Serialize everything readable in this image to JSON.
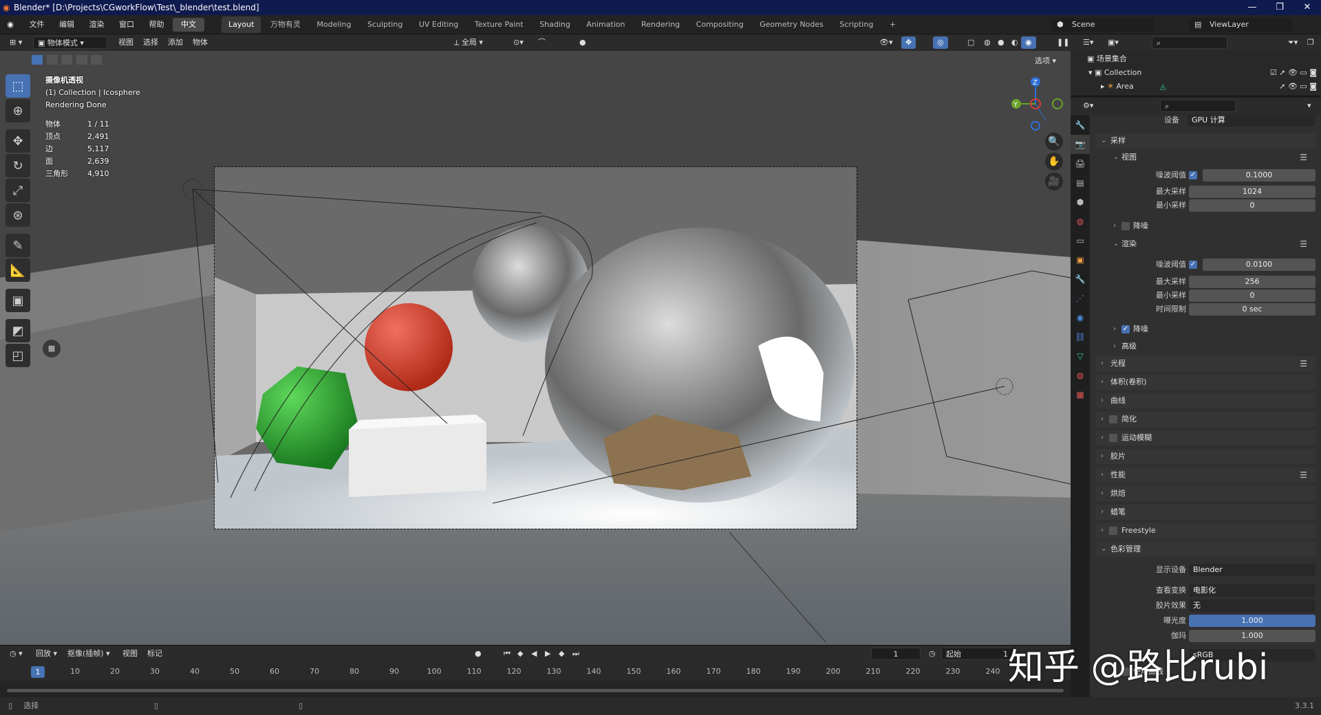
{
  "window": {
    "title": "Blender* [D:\\Projects\\CGworkFlow\\Test\\_blender\\test.blend]"
  },
  "menus": [
    "文件",
    "编辑",
    "渲染",
    "窗口",
    "帮助"
  ],
  "language_btn": "中文",
  "workspaces": [
    "Layout",
    "万物有灵",
    "Modeling",
    "Sculpting",
    "UV Editing",
    "Texture Paint",
    "Shading",
    "Animation",
    "Rendering",
    "Compositing",
    "Geometry Nodes",
    "Scripting"
  ],
  "scene": {
    "label": "Scene",
    "viewlayer": "ViewLayer"
  },
  "viewport_header": {
    "mode": "物体模式",
    "menus": [
      "视图",
      "选择",
      "添加",
      "物体"
    ],
    "transform": "全局",
    "options": "选项"
  },
  "viewport_overlay": {
    "line1": "摄像机透视",
    "line2": "(1) Collection | Icosphere",
    "line3": "Rendering Done"
  },
  "stats": [
    {
      "label": "物体",
      "value": "1 / 11"
    },
    {
      "label": "顶点",
      "value": "2,491"
    },
    {
      "label": "边",
      "value": "5,117"
    },
    {
      "label": "面",
      "value": "2,639"
    },
    {
      "label": "三角形",
      "value": "4,910"
    }
  ],
  "outliner": {
    "root": "场景集合",
    "collection": "Collection",
    "item": "Area"
  },
  "properties": {
    "device_label": "设备",
    "device_value": "GPU 计算",
    "sampling": "采样",
    "viewport": "视图",
    "noise_threshold_label": "噪波阈值",
    "vp_noise_threshold": "0.1000",
    "max_samples_label": "最大采样",
    "vp_max_samples": "1024",
    "min_samples_label": "最小采样",
    "vp_min_samples": "0",
    "denoise": "降噪",
    "render": "渲染",
    "r_noise_threshold": "0.0100",
    "r_max_samples": "256",
    "r_min_samples": "0",
    "time_limit_label": "时间限制",
    "time_limit": "0 sec",
    "render_denoise": "降噪",
    "advanced": "高级",
    "light_paths": "光程",
    "volumes": "体积(卷积)",
    "curves": "曲线",
    "simplify": "简化",
    "motion_blur": "运动模糊",
    "film": "胶片",
    "performance": "性能",
    "bake": "烘焙",
    "grease_pencil": "蜡笔",
    "freestyle": "Freestyle",
    "color_management": "色彩管理",
    "display_device_label": "显示设备",
    "display_device": "Blender",
    "view_transform_label": "查看变换",
    "view_transform": "电影化",
    "look_label": "胶片效果",
    "look": "无",
    "exposure_label": "曝光度",
    "exposure": "1.000",
    "gamma_label": "伽玛",
    "gamma": "1.000",
    "sequencer_value": "sRGB",
    "use_curves": "使用曲线"
  },
  "timeline": {
    "playback": "回放",
    "keying": "抠像(插帧)",
    "view": "视图",
    "marker": "标记",
    "current_frame": "1",
    "start_label": "起始",
    "start": "1",
    "ticks": [
      "10",
      "20",
      "30",
      "40",
      "50",
      "60",
      "70",
      "80",
      "90",
      "100",
      "110",
      "120",
      "130",
      "140",
      "150",
      "160",
      "170",
      "180",
      "190",
      "200",
      "210",
      "220",
      "230",
      "240"
    ],
    "cursor": "1"
  },
  "status": {
    "left": "选择",
    "version": "3.3.1"
  },
  "watermark": "知乎 @路比rubi"
}
